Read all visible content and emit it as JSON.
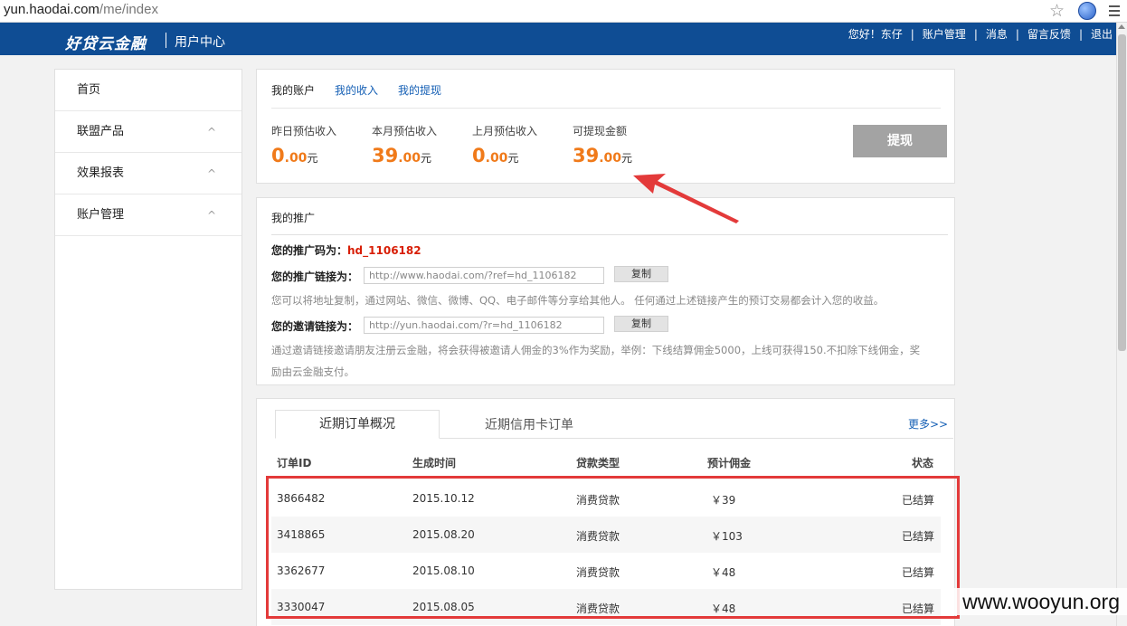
{
  "browser": {
    "url_host": "yun.haodai.com",
    "url_path": "/me/index"
  },
  "header": {
    "logo": "好贷云金融",
    "subtitle": "用户中心",
    "nav": [
      "您好！东仔",
      "账户管理",
      "消息",
      "留言反馈",
      "退出"
    ]
  },
  "sidebar": {
    "items": [
      {
        "label": "首页",
        "caret": ""
      },
      {
        "label": "联盟产品",
        "caret": "^"
      },
      {
        "label": "效果报表",
        "caret": "^"
      },
      {
        "label": "账户管理",
        "caret": "^"
      }
    ]
  },
  "account": {
    "tabs": [
      "我的账户",
      "我的收入",
      "我的提现"
    ],
    "stats": [
      {
        "label": "昨日预估收入",
        "int": "0",
        "dec": ".00",
        "unit": "元"
      },
      {
        "label": "本月预估收入",
        "int": "39",
        "dec": ".00",
        "unit": "元"
      },
      {
        "label": "上月预估收入",
        "int": "0",
        "dec": ".00",
        "unit": "元"
      },
      {
        "label": "可提现金额",
        "int": "39",
        "dec": ".00",
        "unit": "元"
      }
    ],
    "withdraw_label": "提现"
  },
  "promo": {
    "title": "我的推广",
    "code_label": "您的推广码为：",
    "code": "hd_1106182",
    "link_label": "您的推广链接为：",
    "link_value": "http://www.haodai.com/?ref=hd_1106182",
    "invite_label": "您的邀请链接为：",
    "invite_value": "http://yun.haodai.com/?r=hd_1106182",
    "copy_label": "复制",
    "note1": "您可以将地址复制，通过网站、微信、微博、QQ、电子邮件等分享给其他人。 任何通过上述链接产生的预订交易都会计入您的收益。",
    "note2a": "通过邀请链接邀请朋友注册云金融，将会获得被邀请人佣金的3%作为奖励，举例：下线结算佣金5000，上线可获得150.不扣除下线佣金，奖",
    "note2b": "励由云金融支付。"
  },
  "orders": {
    "tab_active": "近期订单概况",
    "tab_other": "近期信用卡订单",
    "more": "更多>>",
    "columns": [
      "订单ID",
      "生成时间",
      "贷款类型",
      "预计佣金",
      "状态"
    ],
    "rows": [
      {
        "id": "3866482",
        "date": "2015.10.12",
        "type": "消费贷款",
        "commission": "￥39",
        "status": "已结算"
      },
      {
        "id": "3418865",
        "date": "2015.08.20",
        "type": "消费贷款",
        "commission": "￥103",
        "status": "已结算"
      },
      {
        "id": "3362677",
        "date": "2015.08.10",
        "type": "消费贷款",
        "commission": "￥48",
        "status": "已结算"
      },
      {
        "id": "3330047",
        "date": "2015.08.05",
        "type": "消费贷款",
        "commission": "￥48",
        "status": "已结算"
      }
    ]
  },
  "watermark": "www.wooyun.org",
  "colors": {
    "header_bg": "#0f4d94",
    "accent_orange": "#f07a1a",
    "code_red": "#d81e06",
    "annotation_red": "#e33a3a"
  }
}
